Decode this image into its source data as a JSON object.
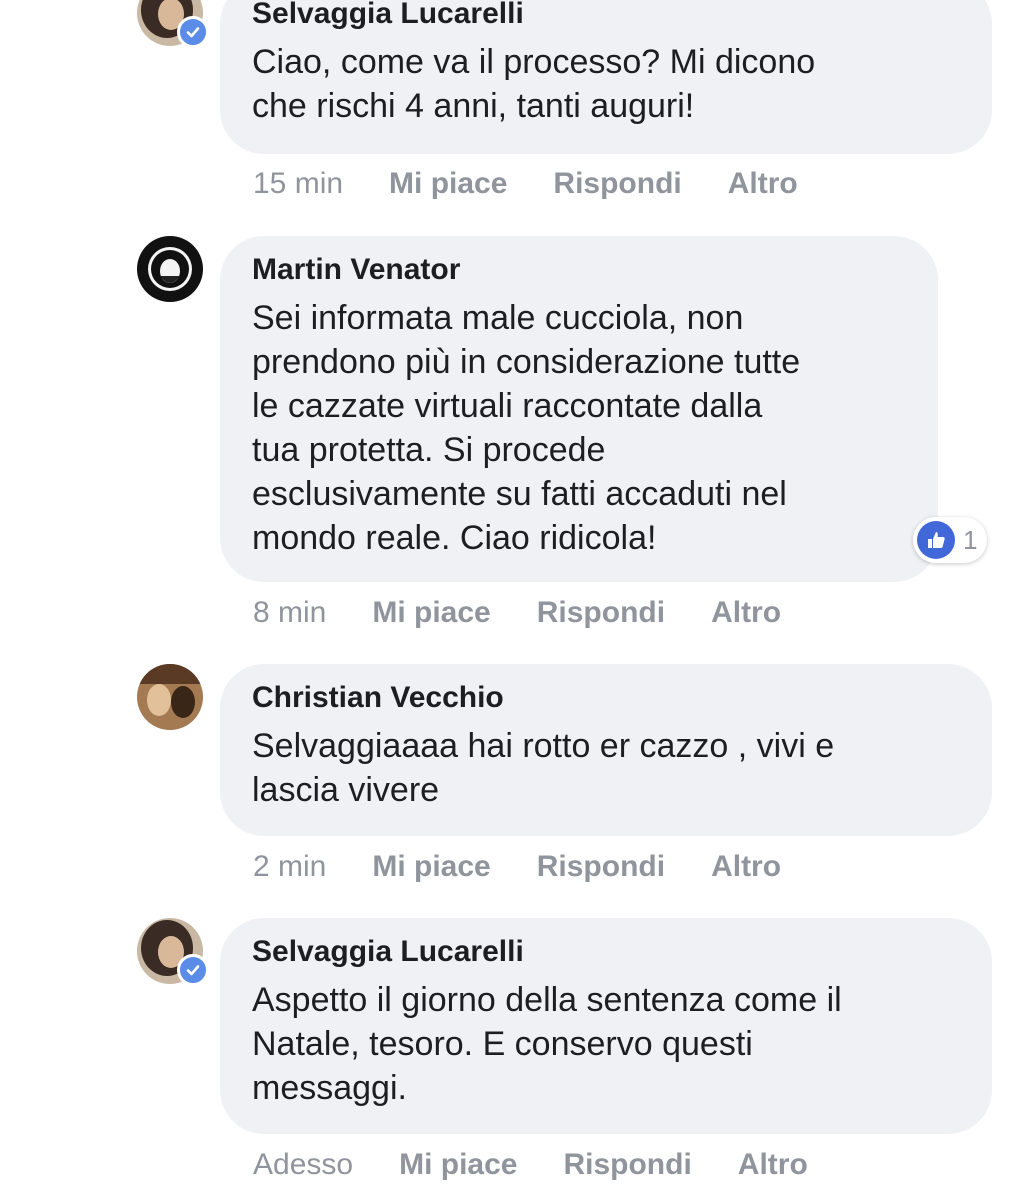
{
  "comments": [
    {
      "author": "Selvaggia Lucarelli",
      "verified": true,
      "text": "Ciao, come va il processo? Mi dicono\nche rischi 4 anni, tanti auguri!",
      "time": "15 min",
      "like_label": "Mi piace",
      "reply_label": "Rispondi",
      "more_label": "Altro"
    },
    {
      "author": "Martin Venator",
      "verified": false,
      "text": "Sei informata male cucciola, non\nprendono più in considerazione tutte\nle cazzate virtuali raccontate dalla\ntua protetta. Si procede\nesclusivamente su fatti accaduti nel\nmondo reale. Ciao ridicola!",
      "time": "8 min",
      "like_label": "Mi piace",
      "reply_label": "Rispondi",
      "more_label": "Altro",
      "reaction_icon": "like-icon",
      "reaction_count": "1"
    },
    {
      "author": "Christian Vecchio",
      "verified": false,
      "text": "Selvaggiaaaa hai rotto er cazzo , vivi e\nlascia vivere",
      "time": "2 min",
      "like_label": "Mi piace",
      "reply_label": "Rispondi",
      "more_label": "Altro"
    },
    {
      "author": "Selvaggia Lucarelli",
      "verified": true,
      "text": "Aspetto il giorno della sentenza come il\nNatale, tesoro. E conservo questi\nmessaggi.",
      "time": "Adesso",
      "like_label": "Mi piace",
      "reply_label": "Rispondi",
      "more_label": "Altro"
    }
  ],
  "colors": {
    "bubble": "#f0f1f5",
    "meta": "#90949c",
    "like": "#4267d8",
    "verified": "#5b8de8"
  }
}
